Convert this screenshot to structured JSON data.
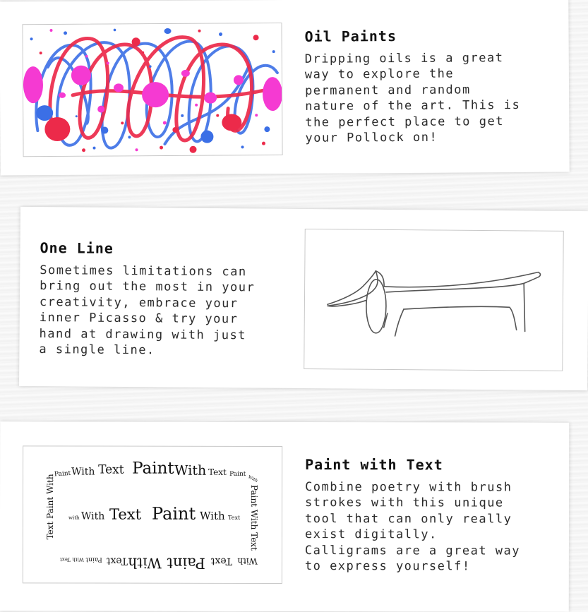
{
  "cards": [
    {
      "title": "Oil Paints",
      "description": "Dripping oils is a great\nway to explore the\npermanent and random\nnature of the art. This is\nthe perfect place to get\nyour Pollock on!",
      "image": "pollock-drip-painting",
      "colors": {
        "pink": "#f53ad2",
        "red": "#ec2a4a",
        "blue": "#3b6fe6"
      }
    },
    {
      "title": "One Line",
      "description": "Sometimes limitations can\nbring out the most in your\ncreativity, embrace your\ninner Picasso & try your\nhand at drawing with just\na single line.",
      "image": "picasso-one-line-dog"
    },
    {
      "title": "Paint with Text",
      "description": "Combine poetry with brush\nstrokes with this unique\ntool that can only really\nexist digitally.\nCalligrams are a great way\nto express yourself!",
      "image": "calligram-text-painting",
      "calligram": {
        "top": [
          "Paint With Text Paint With Text Paint With Text"
        ],
        "middle": "with With Text Paint With Text",
        "bottom": "Paint With Text Paint With Text Paint",
        "left": "Text Paint With Text",
        "right": "Paint With Text"
      }
    }
  ]
}
